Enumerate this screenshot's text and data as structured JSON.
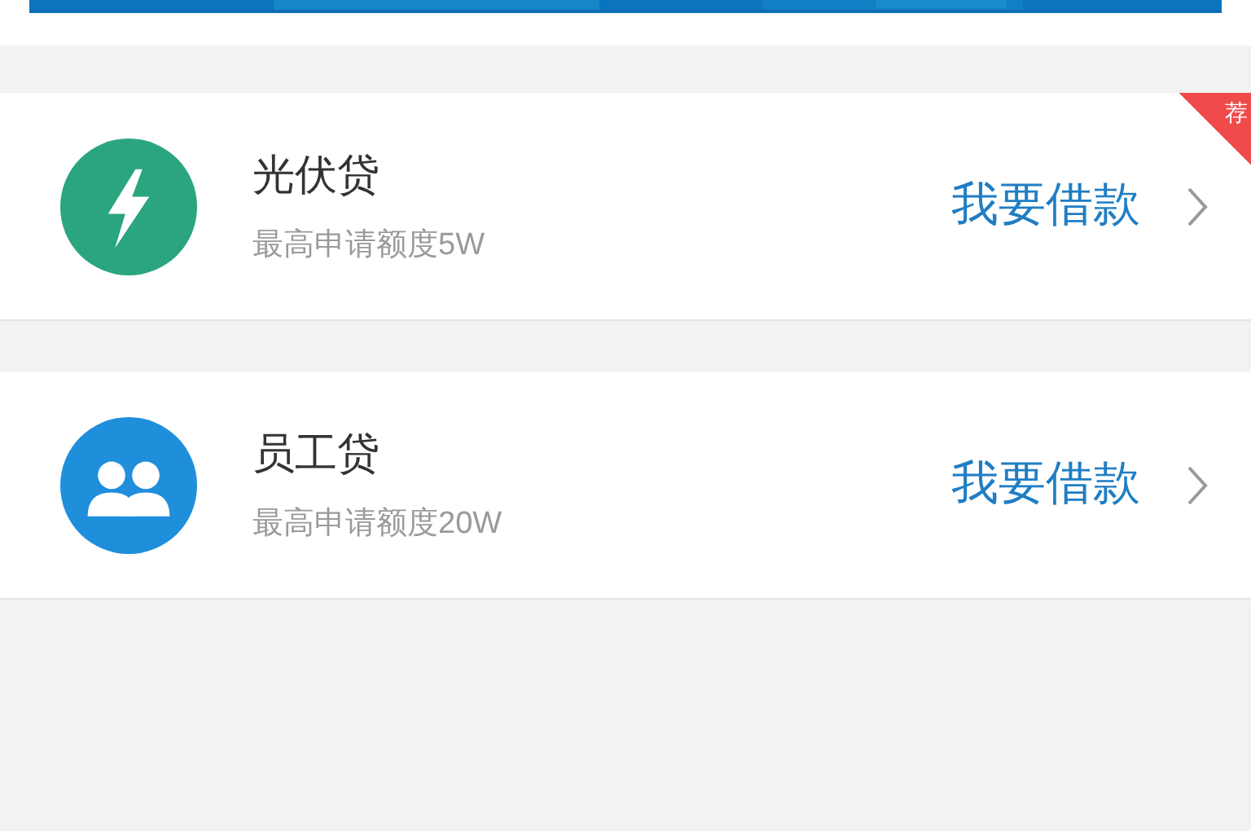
{
  "loans": [
    {
      "kind": "bolt",
      "color": "#2aa57f",
      "name": "光伏贷",
      "limit": "最高申请额度5W",
      "action": "我要借款",
      "badge": "荐"
    },
    {
      "kind": "people",
      "color": "#1f8fdc",
      "name": "员工贷",
      "limit": "最高申请额度20W",
      "action": "我要借款"
    }
  ]
}
